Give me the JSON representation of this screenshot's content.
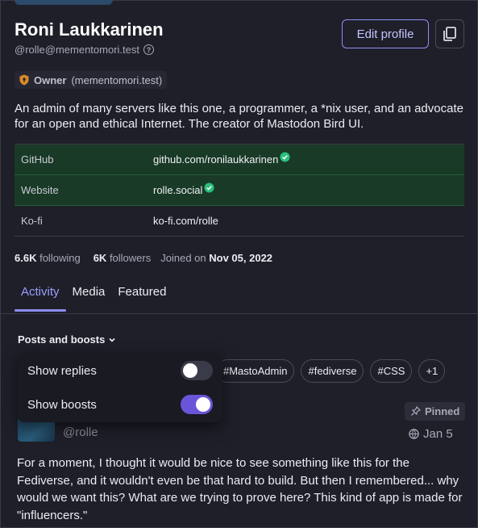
{
  "profile": {
    "name": "Roni Laukkarinen",
    "handle": "@rolle@mementomori.test",
    "role": {
      "label": "Owner",
      "domain": "(mementomori.test)"
    },
    "bio": "An admin of many servers like this one, a programmer, a *nix user, and an advocate for an open and ethical Internet. The creator of Mastodon Bird UI.",
    "edit_label": "Edit profile",
    "fields": [
      {
        "key": "GitHub",
        "value": "github.com/ronilaukkarinen",
        "verified": true
      },
      {
        "key": "Website",
        "value": "rolle.social",
        "verified": true
      },
      {
        "key": "Ko-fi",
        "value": "ko-fi.com/rolle",
        "verified": false
      }
    ],
    "stats": {
      "following_count": "6.6K",
      "following_label": "following",
      "followers_count": "6K",
      "followers_label": "followers",
      "joined_label": "Joined on",
      "joined_date": "Nov 05, 2022"
    }
  },
  "tabs": [
    {
      "label": "Activity",
      "active": true
    },
    {
      "label": "Media",
      "active": false
    },
    {
      "label": "Featured",
      "active": false
    }
  ],
  "filter": {
    "label": "Posts and boosts",
    "menu": [
      {
        "label": "Show replies",
        "enabled": false
      },
      {
        "label": "Show boosts",
        "enabled": true
      }
    ]
  },
  "tags": [
    "#MastoAdmin",
    "#fediverse",
    "#CSS",
    "+1"
  ],
  "post": {
    "handle": "@rolle",
    "pinned_label": "Pinned",
    "date": "Jan 5",
    "text": "For a moment, I thought it would be nice to see something like this for the Fediverse, and it wouldn't even be that hard to build. But then I remembered... why would we want this? What are we trying to prove here? This kind of app is made for \"influencers.\""
  },
  "colors": {
    "accent": "#8d8ef4",
    "verified_bg": "#183a26",
    "verified_check": "#2bbf7e",
    "toggle_on": "#6a55d8"
  }
}
